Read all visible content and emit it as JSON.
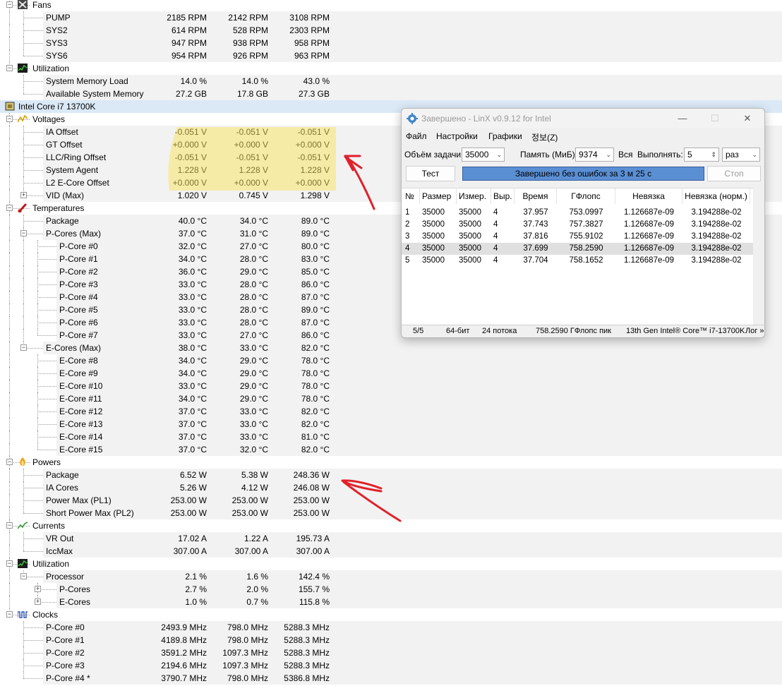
{
  "tree": {
    "rows": [
      {
        "depth": 0,
        "kind": "group",
        "icon": "fan-icon",
        "label": "Fans"
      },
      {
        "depth": 1,
        "kind": "sensor",
        "label": "PUMP",
        "v": [
          "2185 RPM",
          "2142 RPM",
          "3108 RPM"
        ]
      },
      {
        "depth": 1,
        "kind": "sensor",
        "label": "SYS2",
        "v": [
          "614 RPM",
          "528 RPM",
          "2303 RPM"
        ]
      },
      {
        "depth": 1,
        "kind": "sensor",
        "label": "SYS3",
        "v": [
          "947 RPM",
          "938 RPM",
          "958 RPM"
        ]
      },
      {
        "depth": 1,
        "kind": "sensor",
        "label": "SYS6",
        "v": [
          "954 RPM",
          "926 RPM",
          "963 RPM"
        ]
      },
      {
        "depth": 0,
        "kind": "group",
        "icon": "utilization-icon",
        "label": "Utilization"
      },
      {
        "depth": 1,
        "kind": "sensor",
        "label": "System Memory Load",
        "v": [
          "14.0 %",
          "14.0 %",
          "43.0 %"
        ]
      },
      {
        "depth": 1,
        "kind": "sensor",
        "label": "Available System Memory",
        "v": [
          "27.2 GB",
          "17.8 GB",
          "27.3 GB"
        ]
      },
      {
        "depth": -1,
        "kind": "device",
        "icon": "cpu-chip-icon",
        "label": "Intel Core i7 13700K"
      },
      {
        "depth": 0,
        "kind": "group",
        "icon": "voltage-icon",
        "label": "Voltages"
      },
      {
        "depth": 1,
        "kind": "sensor",
        "label": "IA Offset",
        "v": [
          "-0.051 V",
          "-0.051 V",
          "-0.051 V"
        ]
      },
      {
        "depth": 1,
        "kind": "sensor",
        "label": "GT Offset",
        "v": [
          "+0.000 V",
          "+0.000 V",
          "+0.000 V"
        ]
      },
      {
        "depth": 1,
        "kind": "sensor",
        "label": "LLC/Ring Offset",
        "v": [
          "-0.051 V",
          "-0.051 V",
          "-0.051 V"
        ]
      },
      {
        "depth": 1,
        "kind": "sensor",
        "label": "System Agent",
        "v": [
          "1.228 V",
          "1.228 V",
          "1.228 V"
        ]
      },
      {
        "depth": 1,
        "kind": "sensor",
        "label": "L2 E-Core Offset",
        "v": [
          "+0.000 V",
          "+0.000 V",
          "+0.000 V"
        ]
      },
      {
        "depth": 1,
        "kind": "sensor",
        "exp": "+",
        "label": "VID (Max)",
        "v": [
          "1.020 V",
          "0.745 V",
          "1.298 V"
        ]
      },
      {
        "depth": 0,
        "kind": "group",
        "icon": "thermometer-icon",
        "label": "Temperatures"
      },
      {
        "depth": 1,
        "kind": "sensor",
        "label": "Package",
        "v": [
          "40.0 °C",
          "34.0 °C",
          "89.0 °C"
        ]
      },
      {
        "depth": 1,
        "kind": "sensor",
        "exp": "-",
        "label": "P-Cores (Max)",
        "v": [
          "37.0 °C",
          "31.0 °C",
          "89.0 °C"
        ]
      },
      {
        "depth": 2,
        "kind": "sensor",
        "label": "P-Core #0",
        "v": [
          "32.0 °C",
          "27.0 °C",
          "80.0 °C"
        ]
      },
      {
        "depth": 2,
        "kind": "sensor",
        "label": "P-Core #1",
        "v": [
          "34.0 °C",
          "28.0 °C",
          "83.0 °C"
        ]
      },
      {
        "depth": 2,
        "kind": "sensor",
        "label": "P-Core #2",
        "v": [
          "36.0 °C",
          "29.0 °C",
          "85.0 °C"
        ]
      },
      {
        "depth": 2,
        "kind": "sensor",
        "label": "P-Core #3",
        "v": [
          "33.0 °C",
          "28.0 °C",
          "86.0 °C"
        ]
      },
      {
        "depth": 2,
        "kind": "sensor",
        "label": "P-Core #4",
        "v": [
          "33.0 °C",
          "28.0 °C",
          "87.0 °C"
        ]
      },
      {
        "depth": 2,
        "kind": "sensor",
        "label": "P-Core #5",
        "v": [
          "33.0 °C",
          "28.0 °C",
          "89.0 °C"
        ]
      },
      {
        "depth": 2,
        "kind": "sensor",
        "label": "P-Core #6",
        "v": [
          "33.0 °C",
          "28.0 °C",
          "87.0 °C"
        ]
      },
      {
        "depth": 2,
        "kind": "sensor",
        "label": "P-Core #7",
        "v": [
          "33.0 °C",
          "27.0 °C",
          "86.0 °C"
        ]
      },
      {
        "depth": 1,
        "kind": "sensor",
        "exp": "-",
        "label": "E-Cores (Max)",
        "v": [
          "38.0 °C",
          "33.0 °C",
          "82.0 °C"
        ]
      },
      {
        "depth": 2,
        "kind": "sensor",
        "label": "E-Core #8",
        "v": [
          "34.0 °C",
          "29.0 °C",
          "78.0 °C"
        ]
      },
      {
        "depth": 2,
        "kind": "sensor",
        "label": "E-Core #9",
        "v": [
          "34.0 °C",
          "29.0 °C",
          "78.0 °C"
        ]
      },
      {
        "depth": 2,
        "kind": "sensor",
        "label": "E-Core #10",
        "v": [
          "33.0 °C",
          "29.0 °C",
          "78.0 °C"
        ]
      },
      {
        "depth": 2,
        "kind": "sensor",
        "label": "E-Core #11",
        "v": [
          "34.0 °C",
          "29.0 °C",
          "78.0 °C"
        ]
      },
      {
        "depth": 2,
        "kind": "sensor",
        "label": "E-Core #12",
        "v": [
          "37.0 °C",
          "33.0 °C",
          "82.0 °C"
        ]
      },
      {
        "depth": 2,
        "kind": "sensor",
        "label": "E-Core #13",
        "v": [
          "37.0 °C",
          "33.0 °C",
          "82.0 °C"
        ]
      },
      {
        "depth": 2,
        "kind": "sensor",
        "label": "E-Core #14",
        "v": [
          "37.0 °C",
          "33.0 °C",
          "81.0 °C"
        ]
      },
      {
        "depth": 2,
        "kind": "sensor",
        "label": "E-Core #15",
        "v": [
          "37.0 °C",
          "32.0 °C",
          "82.0 °C"
        ]
      },
      {
        "depth": 0,
        "kind": "group",
        "icon": "power-icon",
        "label": "Powers"
      },
      {
        "depth": 1,
        "kind": "sensor",
        "label": "Package",
        "v": [
          "6.52 W",
          "5.38 W",
          "248.36 W"
        ]
      },
      {
        "depth": 1,
        "kind": "sensor",
        "label": "IA Cores",
        "v": [
          "5.26 W",
          "4.12 W",
          "246.08 W"
        ]
      },
      {
        "depth": 1,
        "kind": "sensor",
        "label": "Power Max (PL1)",
        "v": [
          "253.00 W",
          "253.00 W",
          "253.00 W"
        ]
      },
      {
        "depth": 1,
        "kind": "sensor",
        "label": "Short Power Max (PL2)",
        "v": [
          "253.00 W",
          "253.00 W",
          "253.00 W"
        ]
      },
      {
        "depth": 0,
        "kind": "group",
        "icon": "current-icon",
        "label": "Currents"
      },
      {
        "depth": 1,
        "kind": "sensor",
        "label": "VR Out",
        "v": [
          "17.02 A",
          "1.22 A",
          "195.73 A"
        ]
      },
      {
        "depth": 1,
        "kind": "sensor",
        "label": "IccMax",
        "v": [
          "307.00 A",
          "307.00 A",
          "307.00 A"
        ]
      },
      {
        "depth": 0,
        "kind": "group",
        "icon": "utilization-icon",
        "label": "Utilization"
      },
      {
        "depth": 1,
        "kind": "sensor",
        "exp": "-",
        "label": "Processor",
        "v": [
          "2.1 %",
          "1.6 %",
          "142.4 %"
        ]
      },
      {
        "depth": 2,
        "kind": "sensor",
        "exp": "+",
        "label": "P-Cores",
        "v": [
          "2.7 %",
          "2.0 %",
          "155.7 %"
        ]
      },
      {
        "depth": 2,
        "kind": "sensor",
        "exp": "+",
        "label": "E-Cores",
        "v": [
          "1.0 %",
          "0.7 %",
          "115.8 %"
        ]
      },
      {
        "depth": 0,
        "kind": "group",
        "icon": "clock-icon",
        "label": "Clocks"
      },
      {
        "depth": 1,
        "kind": "sensor",
        "label": "P-Core #0",
        "v": [
          "2493.9 MHz",
          "798.0 MHz",
          "5288.3 MHz"
        ]
      },
      {
        "depth": 1,
        "kind": "sensor",
        "label": "P-Core #1",
        "v": [
          "4189.8 MHz",
          "798.0 MHz",
          "5288.3 MHz"
        ]
      },
      {
        "depth": 1,
        "kind": "sensor",
        "label": "P-Core #2",
        "v": [
          "3591.2 MHz",
          "1097.3 MHz",
          "5288.3 MHz"
        ]
      },
      {
        "depth": 1,
        "kind": "sensor",
        "label": "P-Core #3",
        "v": [
          "2194.6 MHz",
          "1097.3 MHz",
          "5288.3 MHz"
        ]
      },
      {
        "depth": 1,
        "kind": "sensor",
        "label": "P-Core #4 *",
        "v": [
          "3790.7 MHz",
          "798.0 MHz",
          "5386.8 MHz"
        ]
      }
    ]
  },
  "linx": {
    "title": "Завершено - LinX v0.9.12 for Intel",
    "menu": [
      "Файл",
      "Настройки",
      "Графики",
      "정보(Z)"
    ],
    "problem_size_label": "Объём задачи:",
    "problem_size_value": "35000",
    "memory_label": "Память (МиБ):",
    "memory_value": "9374",
    "all_label": "Вся",
    "run_label": "Выполнять:",
    "run_value": "5",
    "run_unit": "раз",
    "test_button": "Тест",
    "progress_text": "Завершено без ошибок за 3 м 25 с",
    "progress_fraction": 1.0,
    "stop_button": "Стоп",
    "columns": [
      "№",
      "Размер",
      "Измер.",
      "Выр.",
      "Время",
      "ГФлопс",
      "Невязка",
      "Невязка (норм.)"
    ],
    "rows": [
      [
        "1",
        "35000",
        "35000",
        "4",
        "37.957",
        "753.0997",
        "1.126687e-09",
        "3.194288e-02"
      ],
      [
        "2",
        "35000",
        "35000",
        "4",
        "37.743",
        "757.3827",
        "1.126687e-09",
        "3.194288e-02"
      ],
      [
        "3",
        "35000",
        "35000",
        "4",
        "37.816",
        "755.9102",
        "1.126687e-09",
        "3.194288e-02"
      ],
      [
        "4",
        "35000",
        "35000",
        "4",
        "37.699",
        "758.2590",
        "1.126687e-09",
        "3.194288e-02"
      ],
      [
        "5",
        "35000",
        "35000",
        "4",
        "37.704",
        "758.1652",
        "1.126687e-09",
        "3.194288e-02"
      ]
    ],
    "selected_row": 3,
    "status": [
      "5/5",
      "64-бит",
      "24 потока",
      "758.2590 ГФлопс пик",
      "13th Gen Intel® Core™ i7-13700K",
      "Лог »"
    ]
  },
  "colors": {
    "highlight": "#f7e35a",
    "arrow": "#e0202a",
    "progress": "#5b8fd4",
    "device_row": "#dbe9f7"
  }
}
